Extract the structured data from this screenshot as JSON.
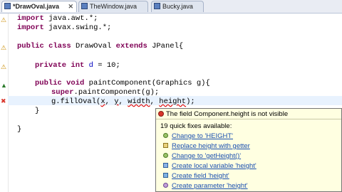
{
  "tabs": [
    {
      "label": "*DrawOval.java",
      "active": true
    },
    {
      "label": "TheWindow.java",
      "active": false
    },
    {
      "label": "Bucky.java",
      "active": false
    }
  ],
  "code": {
    "l1": {
      "kw": "import",
      "rest": " java.awt.*;"
    },
    "l2": {
      "kw": "import",
      "rest": " javax.swing.*;"
    },
    "l3": {
      "kw1": "public",
      "mid1": " ",
      "kw2": "class",
      "rest": " DrawOval ",
      "kw3": "extends",
      "rest2": " JPanel{"
    },
    "l4": {
      "kw1": "private",
      "mid": " ",
      "kw2": "int",
      "sp": " ",
      "field": "d",
      "rest": " = 10;"
    },
    "l5": {
      "kw1": "public",
      "mid": " ",
      "kw2": "void",
      "rest": " paintComponent(Graphics g){"
    },
    "l6": {
      "kw": "super",
      "rest": ".paintComponent(g);"
    },
    "l7": {
      "pre": "g.fillOval(",
      "a1": "x",
      "c1": ", ",
      "a2": "y",
      "c2": ", ",
      "a3": "width",
      "c3": ", ",
      "a4": "height",
      "post": ");"
    },
    "l8": {
      "text": "}"
    },
    "l9": {
      "text": "}"
    }
  },
  "hover": {
    "message": "The field Component.height is not visible",
    "count": "19 quick fixes available:",
    "fixes": [
      {
        "label": "Change to 'HEIGHT'",
        "icon": "change-icon"
      },
      {
        "label": "Replace height with getter",
        "icon": "getter-icon"
      },
      {
        "label": "Change to 'getHeight()'",
        "icon": "change-icon"
      },
      {
        "label": "Create local variable 'height'",
        "icon": "local-variable-icon"
      },
      {
        "label": "Create field 'height'",
        "icon": "field-icon"
      },
      {
        "label": "Create parameter 'height'",
        "icon": "parameter-icon"
      }
    ]
  },
  "colors": {
    "keyword": "#7f0055",
    "field": "#0000c0",
    "link": "#1a4fb0",
    "tooltip_bg": "#ffffe1",
    "error": "#e00000"
  }
}
